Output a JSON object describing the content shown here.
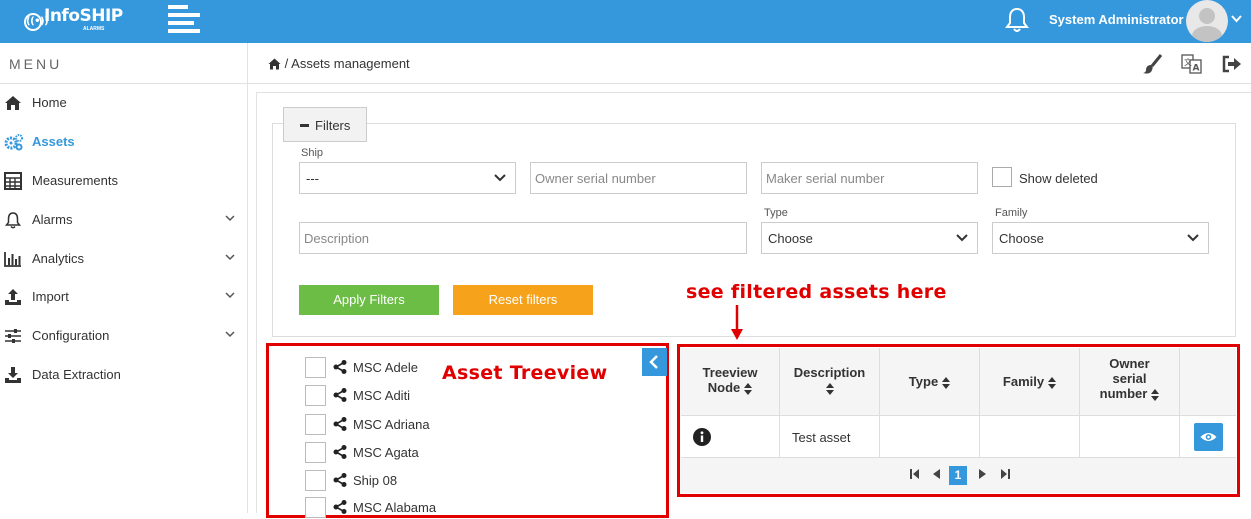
{
  "app": {
    "logo_text": "InfoSHIP",
    "logo_subtitle": "ALARMS",
    "user_name": "System Administrator"
  },
  "sidebar": {
    "title": "MENU",
    "items": [
      {
        "label": "Home",
        "icon": "home-icon"
      },
      {
        "label": "Assets",
        "icon": "gears-icon",
        "active": true
      },
      {
        "label": "Measurements",
        "icon": "calculator-icon"
      },
      {
        "label": "Alarms",
        "icon": "bell-icon",
        "expandable": true
      },
      {
        "label": "Analytics",
        "icon": "bar-chart-icon",
        "expandable": true
      },
      {
        "label": "Import",
        "icon": "upload-icon",
        "expandable": true
      },
      {
        "label": "Configuration",
        "icon": "sliders-icon",
        "expandable": true
      },
      {
        "label": "Data Extraction",
        "icon": "download-icon"
      }
    ]
  },
  "breadcrumb": {
    "separator": "/",
    "current": "Assets management"
  },
  "filters": {
    "toggle_label": "Filters",
    "ship_label": "Ship",
    "ship_value": "---",
    "owner_serial_placeholder": "Owner serial number",
    "maker_serial_placeholder": "Maker serial number",
    "show_deleted_label": "Show deleted",
    "description_placeholder": "Description",
    "type_label": "Type",
    "type_value": "Choose",
    "family_label": "Family",
    "family_value": "Choose",
    "apply_label": "Apply Filters",
    "reset_label": "Reset filters"
  },
  "annotations": {
    "tree_note": "Asset Treeview",
    "grid_note": "see filtered assets here"
  },
  "tree": {
    "nodes": [
      "MSC Adele",
      "MSC Aditi",
      "MSC Adriana",
      "MSC Agata",
      "Ship 08",
      "MSC Alabama"
    ]
  },
  "grid": {
    "columns": [
      {
        "line1": "Treeview",
        "line2": "Node"
      },
      {
        "line1": "Description"
      },
      {
        "line1": "Type"
      },
      {
        "line1": "Family"
      },
      {
        "line1": "Owner",
        "line2": "serial",
        "line3": "number"
      },
      {
        "line1": ""
      }
    ],
    "rows": [
      {
        "node_icon": "info-icon",
        "description": "Test asset",
        "type": "",
        "family": "",
        "owner_serial": "",
        "action_icon": "eye-icon"
      }
    ],
    "current_page": "1"
  },
  "colors": {
    "primary": "#3598dc",
    "apply_button": "#6cbd45",
    "reset_button": "#f7a21b",
    "annotation": "#e00000"
  }
}
